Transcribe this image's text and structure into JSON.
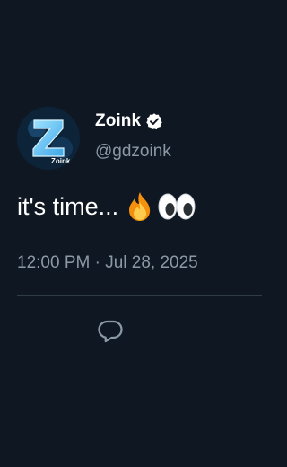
{
  "tweet": {
    "author": {
      "display_name": "Zoink",
      "handle": "@gdzoink",
      "verified": true,
      "avatar_icon": "zoink-avatar",
      "avatar_text": "Zoink"
    },
    "text": "it's time...",
    "emojis": [
      "fire-emoji",
      "eyes-emoji"
    ],
    "timestamp": "12:00 PM · Jul 28, 2025",
    "actions": {
      "reply_icon": "reply-icon"
    }
  },
  "colors": {
    "background": "#0f1722",
    "primary_text": "#ffffff",
    "secondary_text": "#8b98a5",
    "divider": "#2f3b47",
    "verified_badge": "#ffffff"
  }
}
